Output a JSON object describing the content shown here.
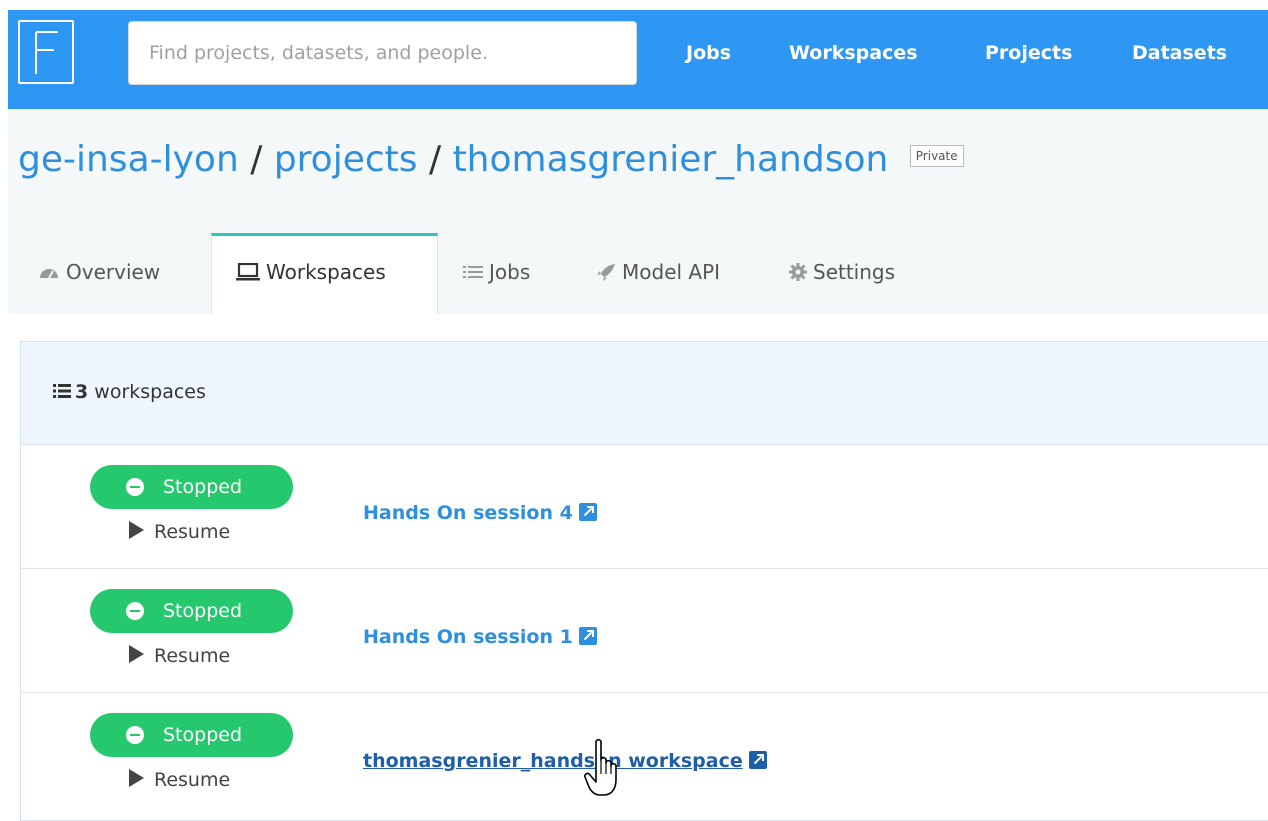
{
  "topbar": {
    "search_placeholder": "Find projects, datasets, and people.",
    "nav": [
      "Jobs",
      "Workspaces",
      "Projects",
      "Datasets"
    ]
  },
  "breadcrumb": {
    "org": "ge-insa-lyon",
    "section": "projects",
    "project": "thomasgrenier_handson",
    "separator": "/",
    "visibility": "Private"
  },
  "tabs": [
    {
      "label": "Overview",
      "icon": "dashboard-icon"
    },
    {
      "label": "Workspaces",
      "icon": "laptop-icon"
    },
    {
      "label": "Jobs",
      "icon": "list-icon"
    },
    {
      "label": "Model API",
      "icon": "rocket-icon"
    },
    {
      "label": "Settings",
      "icon": "gear-icon"
    }
  ],
  "workspaces": {
    "count": "3",
    "count_label": "workspaces",
    "items": [
      {
        "status": "Stopped",
        "action": "Resume",
        "name": "Hands On session 4"
      },
      {
        "status": "Stopped",
        "action": "Resume",
        "name": "Hands On session 1"
      },
      {
        "status": "Stopped",
        "action": "Resume",
        "name": "thomasgrenier_handson workspace"
      }
    ]
  },
  "colors": {
    "topbar": "#2d97f3",
    "link": "#2d8fde",
    "status_green": "#26c86e",
    "active_tab_accent": "#2ec4b6"
  }
}
